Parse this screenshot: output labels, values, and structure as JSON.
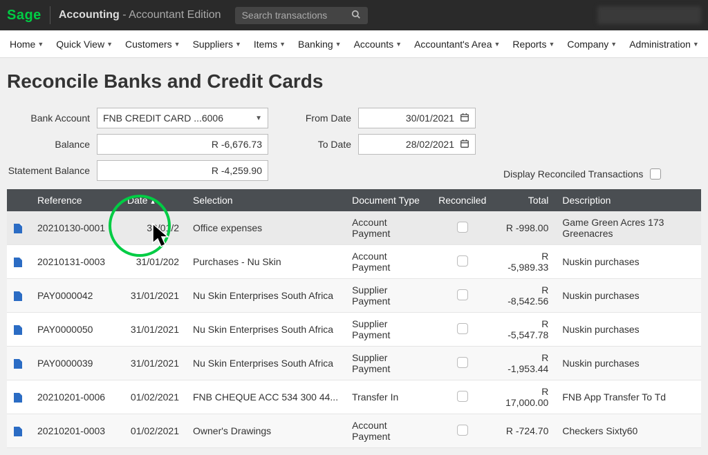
{
  "header": {
    "logo": "Sage",
    "app": "Accounting",
    "edition": "- Accountant Edition",
    "search_placeholder": "Search transactions"
  },
  "nav": [
    "Home",
    "Quick View",
    "Customers",
    "Suppliers",
    "Items",
    "Banking",
    "Accounts",
    "Accountant's Area",
    "Reports",
    "Company",
    "Administration"
  ],
  "page": {
    "title": "Reconcile Banks and Credit Cards",
    "bank_label": "Bank Account",
    "bank_value": "FNB CREDIT CARD ...6006",
    "balance_label": "Balance",
    "balance_value": "R -6,676.73",
    "stmt_label": "Statement Balance",
    "stmt_value": "R -4,259.90",
    "from_label": "From Date",
    "from_value": "30/01/2021",
    "to_label": "To Date",
    "to_value": "28/02/2021",
    "display_label": "Display Reconciled Transactions"
  },
  "columns": {
    "reference": "Reference",
    "date": "Date",
    "selection": "Selection",
    "doctype": "Document Type",
    "reconciled": "Reconciled",
    "total": "Total",
    "description": "Description"
  },
  "rows": [
    {
      "ref": "20210130-0001",
      "date": "30/01/2",
      "sel": "Office expenses",
      "doctype": "Account Payment",
      "total": "R -998.00",
      "desc": "Game Green Acres 173 Greenacres"
    },
    {
      "ref": "20210131-0003",
      "date": "31/01/202",
      "sel": "Purchases - Nu Skin",
      "doctype": "Account Payment",
      "total": "R -5,989.33",
      "desc": "Nuskin purchases"
    },
    {
      "ref": "PAY0000042",
      "date": "31/01/2021",
      "sel": "Nu Skin Enterprises South Africa",
      "doctype": "Supplier Payment",
      "total": "R -8,542.56",
      "desc": "Nuskin purchases"
    },
    {
      "ref": "PAY0000050",
      "date": "31/01/2021",
      "sel": "Nu Skin Enterprises South Africa",
      "doctype": "Supplier Payment",
      "total": "R -5,547.78",
      "desc": "Nuskin purchases"
    },
    {
      "ref": "PAY0000039",
      "date": "31/01/2021",
      "sel": "Nu Skin Enterprises South Africa",
      "doctype": "Supplier Payment",
      "total": "R -1,953.44",
      "desc": "Nuskin purchases"
    },
    {
      "ref": "20210201-0006",
      "date": "01/02/2021",
      "sel": "FNB CHEQUE ACC 534 300 44...",
      "doctype": "Transfer In",
      "total": "R 17,000.00",
      "desc": "FNB App Transfer To Td"
    },
    {
      "ref": "20210201-0003",
      "date": "01/02/2021",
      "sel": "Owner's Drawings",
      "doctype": "Account Payment",
      "total": "R -724.70",
      "desc": "Checkers Sixty60"
    }
  ]
}
